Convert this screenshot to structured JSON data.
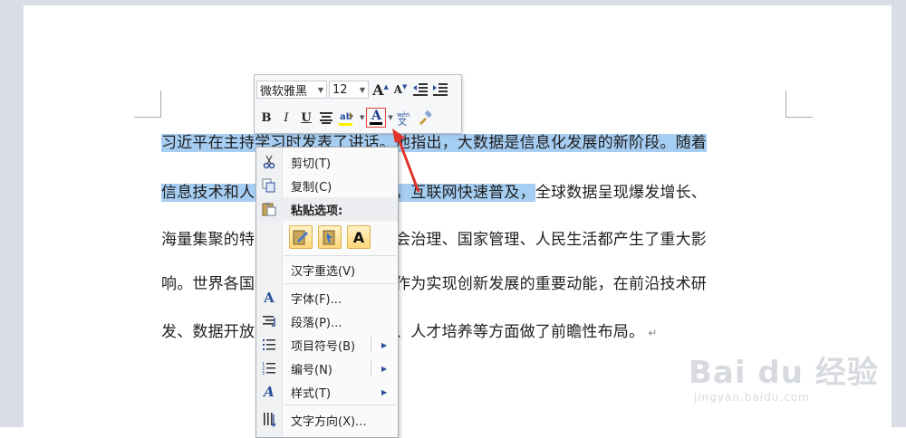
{
  "document": {
    "lines": [
      {
        "selected": "习近平在主持学习时发表了讲话。他指出，大数据是信息化发展的新阶段。随着",
        "rest": ""
      },
      {
        "selected": "信息技术和人类生产生活交汇融合，互联网快速普及，",
        "rest": "全球数据呈现爆发增长、"
      },
      {
        "selected": "",
        "rest": "海量集聚的特点，对经济发展、社会治理、国家管理、人民生活都产生了重大影"
      },
      {
        "selected": "",
        "rest": "响。世界各国都把推进经济数字化作为实现创新发展的重要动能，在前沿技术研"
      },
      {
        "selected": "",
        "rest": "发、数据开放共享、隐私安全保护、人才培养等方面做了前瞻性布局。",
        "para_mark": "↵"
      }
    ]
  },
  "mini_toolbar": {
    "font_name": "微软雅黑",
    "font_size": "12",
    "grow_font": "A",
    "shrink_font": "A",
    "bold": "B",
    "italic": "I",
    "underline": "U",
    "font_color_label": "A",
    "font_color": "#000000",
    "highlight_color": "#ffee00"
  },
  "context_menu": {
    "items": [
      {
        "label": "剪切(T)",
        "icon": "scissors-icon"
      },
      {
        "label": "复制(C)",
        "icon": "copy-icon"
      },
      {
        "label": "粘贴选项:",
        "icon": "paste-icon"
      },
      {
        "label": "汉字重选(V)",
        "icon": ""
      },
      {
        "label": "字体(F)...",
        "icon": "font-icon"
      },
      {
        "label": "段落(P)...",
        "icon": "paragraph-icon"
      },
      {
        "label": "项目符号(B)",
        "icon": "bullets-icon"
      },
      {
        "label": "编号(N)",
        "icon": "numbering-icon"
      },
      {
        "label": "样式(T)",
        "icon": "styles-icon"
      },
      {
        "label": "文字方向(X)...",
        "icon": "text-direction-icon"
      }
    ],
    "paste_options": [
      "keep-source-formatting",
      "merge-formatting",
      "keep-text-only"
    ],
    "paste_text_only_label": "A"
  },
  "watermark": {
    "brand": "Bai du 经验",
    "url": "jingyan.baidu.com"
  },
  "colors": {
    "selection": "#a6cdf2",
    "annotation": "#e0332b",
    "accent": "#2b4f9b"
  }
}
